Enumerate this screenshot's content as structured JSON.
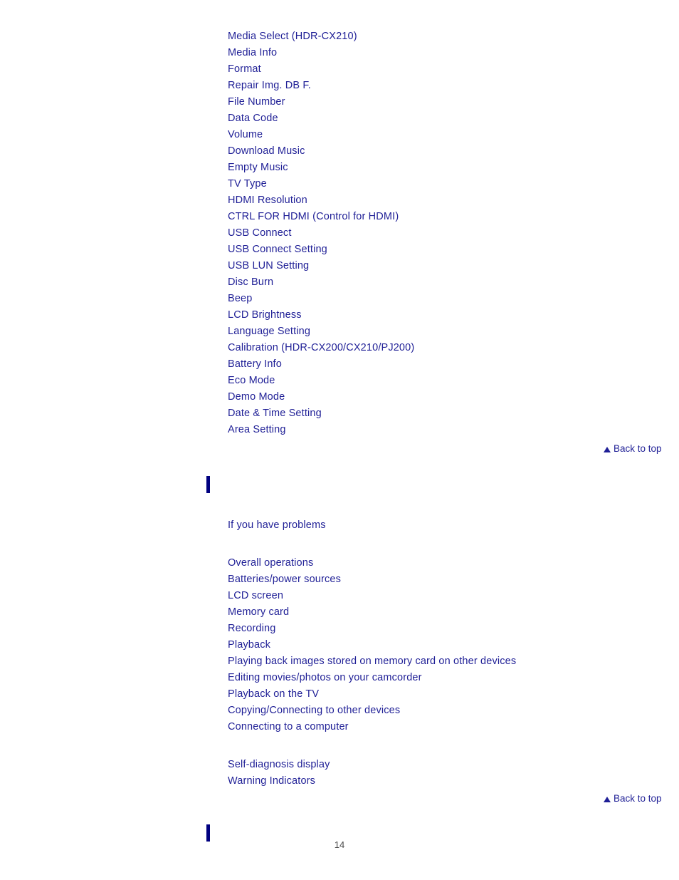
{
  "page": {
    "number": "14"
  },
  "settings_section": {
    "items": [
      {
        "label": "Media Select (HDR-CX210)"
      },
      {
        "label": "Media Info"
      },
      {
        "label": "Format"
      },
      {
        "label": "Repair Img. DB F."
      },
      {
        "label": "File Number"
      },
      {
        "label": "Data Code"
      },
      {
        "label": "Volume"
      },
      {
        "label": "Download Music"
      },
      {
        "label": "Empty Music"
      },
      {
        "label": "TV Type"
      },
      {
        "label": "HDMI Resolution"
      },
      {
        "label": "CTRL FOR HDMI (Control for HDMI)"
      },
      {
        "label": "USB Connect"
      },
      {
        "label": "USB Connect Setting"
      },
      {
        "label": "USB LUN Setting"
      },
      {
        "label": "Disc Burn"
      },
      {
        "label": "Beep"
      },
      {
        "label": "LCD Brightness"
      },
      {
        "label": "Language Setting"
      },
      {
        "label": "Calibration (HDR-CX200/CX210/PJ200)"
      },
      {
        "label": "Battery Info"
      },
      {
        "label": "Eco Mode"
      },
      {
        "label": "Demo Mode"
      },
      {
        "label": "Date & Time Setting"
      },
      {
        "label": "Area Setting"
      }
    ]
  },
  "troubleshooting_section": {
    "heading": "",
    "intro_link": "If you have problems",
    "items": [
      {
        "label": "Overall operations"
      },
      {
        "label": "Batteries/power sources"
      },
      {
        "label": "LCD screen"
      },
      {
        "label": "Memory card"
      },
      {
        "label": "Recording"
      },
      {
        "label": "Playback"
      },
      {
        "label": "Playing back images stored on memory card on other devices"
      },
      {
        "label": "Editing movies/photos on your camcorder"
      },
      {
        "label": "Playback on the TV"
      },
      {
        "label": "Copying/Connecting to other devices"
      },
      {
        "label": "Connecting to a computer"
      }
    ],
    "diagnostics": [
      {
        "label": "Self-diagnosis display"
      },
      {
        "label": "Warning Indicators"
      }
    ]
  },
  "footer_section": {
    "heading": ""
  },
  "back_to_top": {
    "label": "Back to top",
    "icon": "triangle-up-icon"
  },
  "colors": {
    "link": "#1f1f96",
    "marker": "#000080",
    "page_number": "#4a4a4a",
    "background": "#ffffff"
  }
}
